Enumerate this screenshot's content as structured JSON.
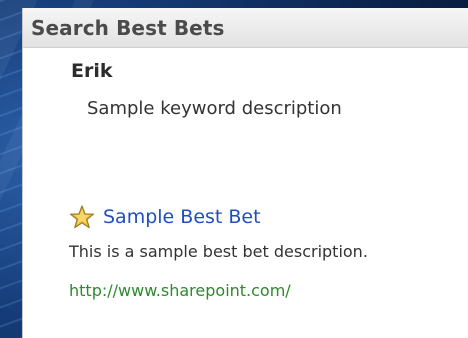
{
  "web_part": {
    "title": "Search Best Bets"
  },
  "keyword": {
    "term": "Erik",
    "description": "Sample keyword description"
  },
  "best_bet": {
    "title": "Sample Best Bet",
    "description": "This is a sample best bet description.",
    "url": "http://www.sharepoint.com/",
    "icon": "star-icon"
  },
  "colors": {
    "title_text": "#4b4b4b",
    "link": "#1f4fbf",
    "url": "#2d8a2d",
    "star": "#f2c230"
  }
}
